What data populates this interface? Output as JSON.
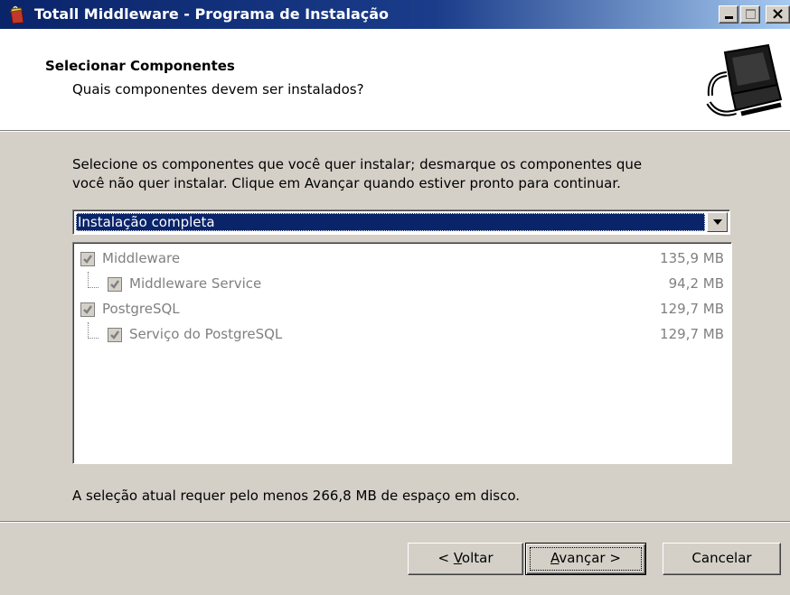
{
  "window": {
    "title": "Totall Middleware - Programa de Instalação"
  },
  "header": {
    "title": "Selecionar Componentes",
    "subtitle": "Quais componentes devem ser instalados?",
    "image_icon": "computer-install-icon"
  },
  "instructions": {
    "line1": "Selecione os componentes que você quer instalar; desmarque os componentes que",
    "line2": "você não quer instalar. Clique em Avançar quando estiver pronto para continuar."
  },
  "install_type": {
    "selected": "Instalação completa"
  },
  "components": [
    {
      "label": "Middleware",
      "size": "135,9 MB",
      "checked": true,
      "level": 0
    },
    {
      "label": "Middleware Service",
      "size": "94,2 MB",
      "checked": true,
      "level": 1
    },
    {
      "label": "PostgreSQL",
      "size": "129,7 MB",
      "checked": true,
      "level": 0
    },
    {
      "label": "Serviço do PostgreSQL",
      "size": "129,7 MB",
      "checked": true,
      "level": 1
    }
  ],
  "disk_space": "A seleção atual requer pelo menos 266,8 MB de espaço em disco.",
  "buttons": {
    "back_prefix": "< ",
    "back_accel": "V",
    "back_rest": "oltar",
    "next_accel": "A",
    "next_rest": "vançar >",
    "cancel": "Cancelar"
  },
  "colors": {
    "titlebar": "#0a246a",
    "dialog_bg": "#d4d0c8",
    "selection": "#0a246a",
    "disabled_text": "#808080"
  }
}
